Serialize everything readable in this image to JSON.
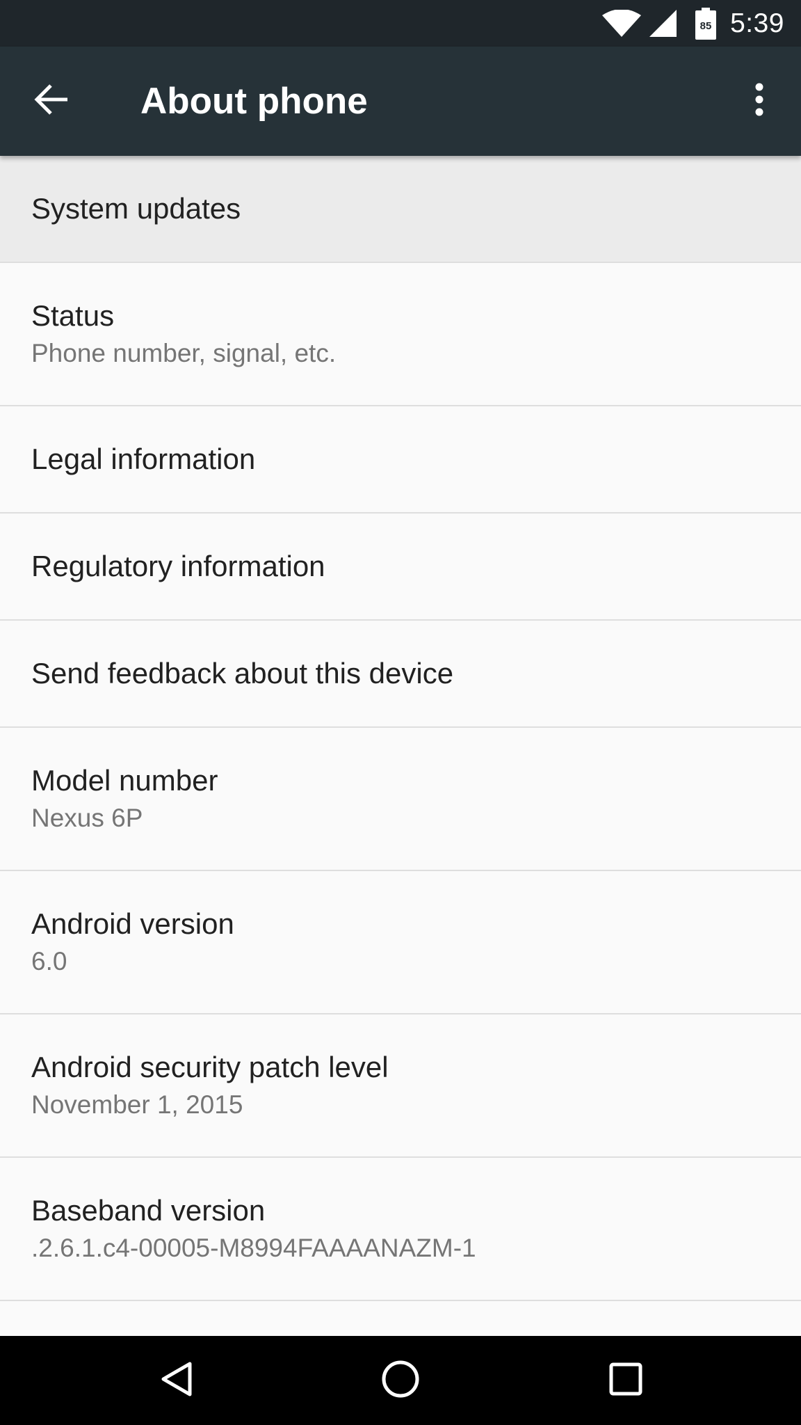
{
  "status_bar": {
    "time": "5:39",
    "battery_level": "85",
    "icons": [
      "wifi-icon",
      "cell-signal-icon",
      "battery-icon"
    ]
  },
  "app_bar": {
    "title": "About phone",
    "back_icon": "arrow-back-icon",
    "menu_icon": "more-vert-icon"
  },
  "items": [
    {
      "title": "System updates",
      "summary": "",
      "highlighted": true
    },
    {
      "title": "Status",
      "summary": "Phone number, signal, etc."
    },
    {
      "title": "Legal information",
      "summary": ""
    },
    {
      "title": "Regulatory information",
      "summary": ""
    },
    {
      "title": "Send feedback about this device",
      "summary": ""
    },
    {
      "title": "Model number",
      "summary": "Nexus 6P"
    },
    {
      "title": "Android version",
      "summary": "6.0"
    },
    {
      "title": "Android security patch level",
      "summary": "November 1, 2015"
    },
    {
      "title": "Baseband version",
      "summary": ".2.6.1.c4-00005-M8994FAAAANAZM-1"
    },
    {
      "title": "",
      "summary": ""
    }
  ],
  "nav_bar": {
    "icons": [
      "nav-back-icon",
      "nav-home-icon",
      "nav-recents-icon"
    ]
  },
  "colors": {
    "status_bar": "#1f262b",
    "app_bar": "#263238",
    "background": "#fafafa",
    "highlight": "#ebebeb",
    "divider": "#dedede",
    "primary_text": "#212121",
    "secondary_text": "#757575"
  }
}
